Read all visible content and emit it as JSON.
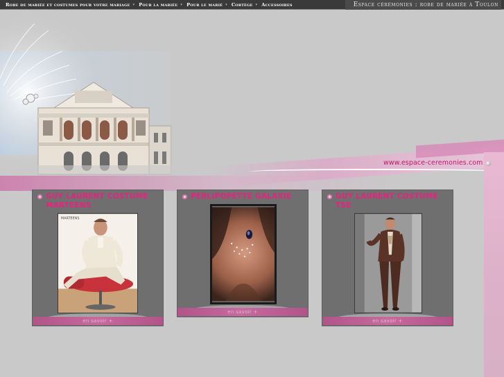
{
  "nav": {
    "items": [
      {
        "label": "Robe de mariée et costumes pour votre mariage"
      },
      {
        "label": "Pour la mariée"
      },
      {
        "label": "Pour le marié"
      },
      {
        "label": "Cortège"
      },
      {
        "label": "Accessoires"
      }
    ]
  },
  "site_title": "Espace cérémonies : robe de mariée à Toulon",
  "header": {
    "url": "www.espace-ceremonies.com"
  },
  "cards": [
    {
      "title": "GUY LAURENT COSTUME MARTEENS",
      "link": "en savoir +",
      "image_text": "MARTEENS"
    },
    {
      "title": "PERLIPOPETTE GALAXIE",
      "link": "en savoir +"
    },
    {
      "title": "GUY LAURENT COSTUME TSE",
      "link": "en savoir +"
    }
  ],
  "colors": {
    "accent_pink": "#e9217f",
    "url_color": "#c0186c",
    "card_bg": "#6f6f6f",
    "nav_bg": "#3a3a3a"
  }
}
